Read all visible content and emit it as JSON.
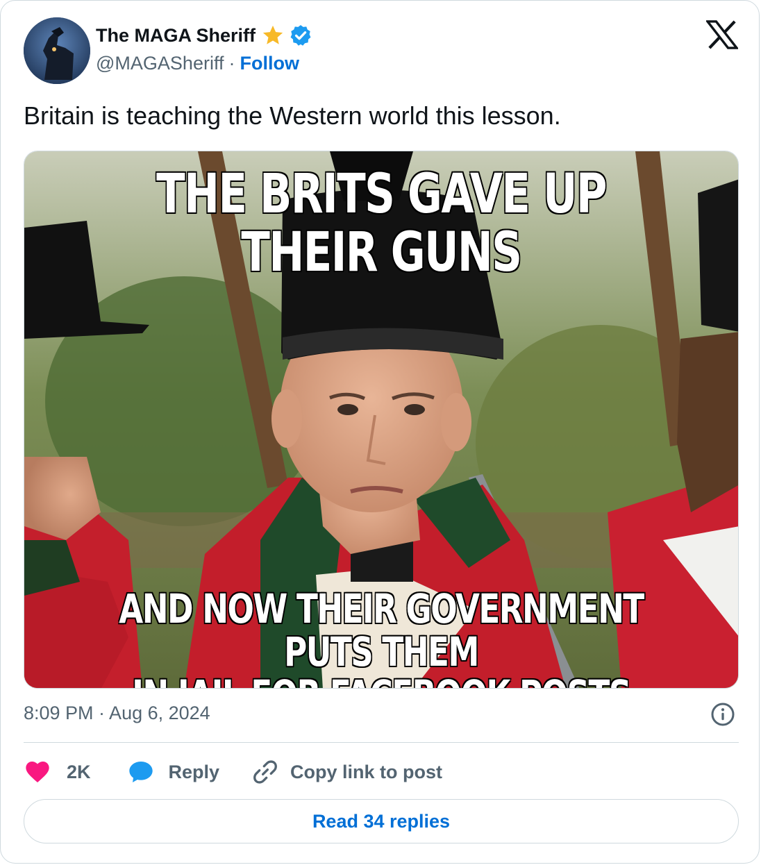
{
  "author": {
    "display_name": "The MAGA Sheriff",
    "handle": "@MAGASheriff",
    "separator": "·",
    "follow_label": "Follow"
  },
  "tweet": {
    "text": "Britain is teaching the Western world this lesson."
  },
  "media": {
    "caption_top": "THE BRITS GAVE UP THEIR GUNS",
    "caption_bottom_line1": "AND NOW THEIR GOVERNMENT PUTS THEM",
    "caption_bottom_line2": "IN JAIL FOR FACEBOOK POSTS"
  },
  "meta": {
    "timestamp": "8:09 PM · Aug 6, 2024"
  },
  "actions": {
    "like_count": "2K",
    "reply_label": "Reply",
    "copy_label": "Copy link to post"
  },
  "footer": {
    "read_replies_label": "Read 34 replies"
  },
  "colors": {
    "link_blue": "#006fd6",
    "like_pink": "#f91880",
    "reply_blue": "#1d9bf0",
    "verified_blue": "#1d9bf0",
    "star_gold": "#f7b928"
  },
  "icons": [
    "star-icon",
    "verified-badge-icon",
    "x-logo-icon",
    "info-icon",
    "heart-icon",
    "speech-bubble-icon",
    "link-icon"
  ]
}
